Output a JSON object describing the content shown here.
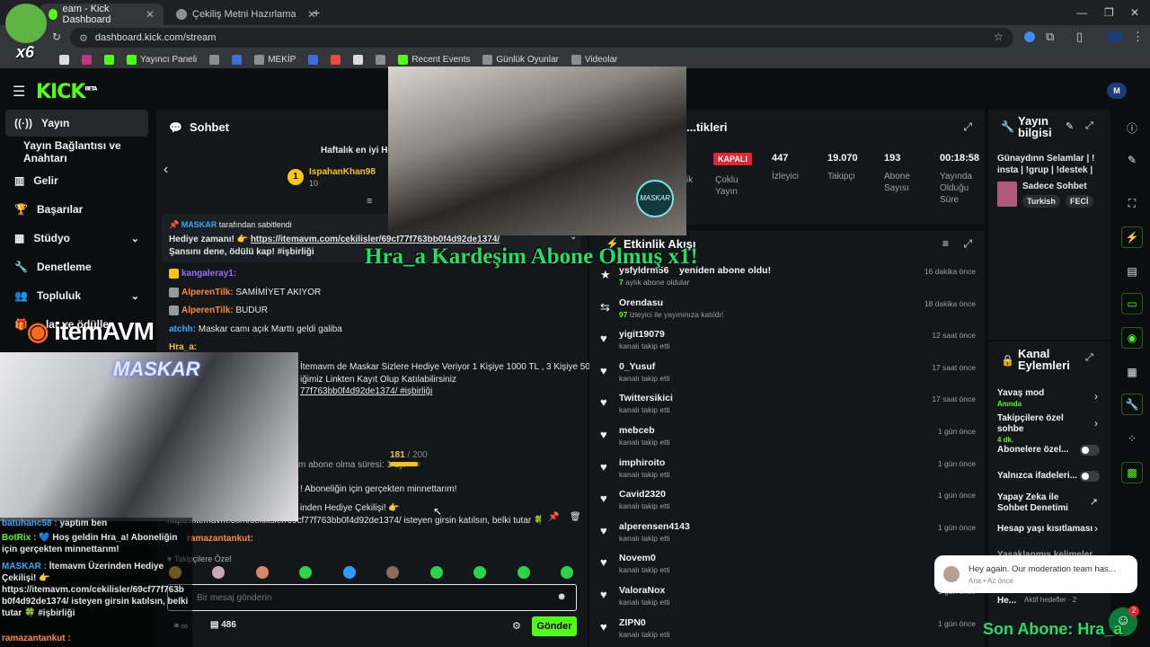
{
  "browser": {
    "tabs": [
      {
        "title": "eam - Kick Dashboard",
        "active": true
      },
      {
        "title": "Çekiliş Metni Hazırlama",
        "active": false
      }
    ],
    "url": "dashboard.kick.com/stream",
    "bookmarks": [
      "Yayıncı Paneli",
      "MEKİP",
      "Recent Events",
      "Günlük Oyunlar",
      "Videolar"
    ]
  },
  "kick": {
    "logo": "KICK",
    "logo_sup": "BETA",
    "avatar_label": "M"
  },
  "sidebar": {
    "items": [
      {
        "label": "Yayın",
        "icon": "broadcast-icon"
      },
      {
        "label": "Yayın Bağlantısı ve Anahtarı"
      },
      {
        "label": "Gelir",
        "icon": "revenue-icon"
      },
      {
        "label": "Başarılar",
        "icon": "trophy-icon"
      },
      {
        "label": "Stüdyo",
        "icon": "studio-icon"
      },
      {
        "label": "Denetleme",
        "icon": "wrench-icon"
      },
      {
        "label": "Topluluk",
        "icon": "community-icon"
      },
      {
        "label": "...lar ve ödüller",
        "icon": "rewards-icon"
      }
    ]
  },
  "chat": {
    "title": "Sohbet",
    "leaderboard_title": "Haftalık en iyi He...",
    "leader_name": "IspahanKhan98",
    "leader_rank": "1",
    "leader_value": "10",
    "pinned_by": "MASKAR",
    "pinned_suffix": "tarafından sabitlendi",
    "pinned_msg_prefix": "Hediye zamanı! 👉",
    "pinned_link": "https://itemavm.com/cekilisler/69cf77f763bb0f4d92de1374/",
    "pinned_msg_suffix": "Şansını dene, ödülü kap! #işbirliği",
    "messages": [
      {
        "user": "kangaleray1:",
        "text": ""
      },
      {
        "user": "AlperenTilk:",
        "text": "SAMİMİYET AKIYOR"
      },
      {
        "user": "AlperenTilk:",
        "text": "BUDUR"
      },
      {
        "user": "atchh:",
        "text": "Maskar camı açık Marttı geldi galiba"
      },
      {
        "user": "Hra_a:",
        "text": ""
      }
    ],
    "promo_line1": "İtemavm de Maskar Sizlere Hediye Veriyor 1 Kişiye 1000 TL , 3 Kişiye 500",
    "promo_line2": "iğimiz Linkten Kayıt Olup Katılabilirsiniz",
    "promo_line3": "77f763bb0f4d92de1374/ #işbirliği",
    "sub_progress_value": "181",
    "sub_progress_total": "/ 200",
    "sub_progress_fraction": 0.905,
    "sub_duration": "m abone olma süresi: 1 ay.",
    "thanks": "! Aboneliğin için gerçekten minnettarım!",
    "gift_line": "inden Hediye Çekilişi! 👉",
    "gift_link_line": "https://itemavm.com/cekilisler/69cf77f763bb0f4d92de1374/ isteyen girsin katılsın, belki tutar 🍀 #işbirliği",
    "ramazan_user": "ramazantankut:",
    "followers_only": "Takipçilere Özel",
    "input_placeholder": "Bir mesaj gönderin",
    "viewer_count": "486",
    "send_label": "Gönder"
  },
  "overlay_chat": [
    {
      "user": "batuhanc58 :",
      "text": "yaptım ben"
    },
    {
      "user": "BotRix :",
      "text": "💙 Hoş geldin Hra_a! Aboneliğin için gerçekten minnettarım!"
    },
    {
      "user": "MASKAR :",
      "text": "İtemavm Üzerinden Hediye Çekilişi! 👉 https://itemavm.com/cekilisler/69cf77f763b b0f4d92de1374/ isteyen girsin katılsın, belki tutar 🍀 #işbirliği"
    },
    {
      "user": "ramazantankut :",
      "text": ""
    }
  ],
  "stream_info": {
    "title": "...tikleri",
    "status": "KAPALI",
    "mode_label": "Çoklu Yayın",
    "partial_label": "ik",
    "stats": [
      {
        "value": "447",
        "label": "İzleyici"
      },
      {
        "value": "19.070",
        "label": "Takipçi"
      },
      {
        "value": "193",
        "label": "Abone Sayısı"
      },
      {
        "value": "00:18:58",
        "label": "Yayında Olduğu Süre"
      }
    ]
  },
  "activity": {
    "title": "Etkinlik Akışı",
    "items": [
      {
        "user": "ysfyldrm56",
        "action_inline": "yeniden abone oldu!",
        "detail_hl": "7",
        "detail": "aylık abone oldular",
        "time": "16 dakika önce",
        "icon": "star-icon"
      },
      {
        "user": "Orendasu",
        "action_inline": "",
        "detail_hl": "97",
        "detail": "izleyici ile yayınınıza katıldı!",
        "time": "18 dakika önce",
        "icon": "raid-icon"
      },
      {
        "user": "yigit19079",
        "detail": "kanalı takip etti",
        "time": "12 saat önce",
        "icon": "heart-icon"
      },
      {
        "user": "0_Yusuf",
        "detail": "kanalı takip etti",
        "time": "17 saat önce",
        "icon": "heart-icon"
      },
      {
        "user": "Twittersikici",
        "detail": "kanalı takip etti",
        "time": "17 saat önce",
        "icon": "heart-icon"
      },
      {
        "user": "mebceb",
        "detail": "kanalı takip etti",
        "time": "1 gün önce",
        "icon": "heart-icon"
      },
      {
        "user": "imphiroito",
        "detail": "kanalı takip etti",
        "time": "1 gün önce",
        "icon": "heart-icon"
      },
      {
        "user": "Cavid2320",
        "detail": "kanalı takip etti",
        "time": "1 gün önce",
        "icon": "heart-icon"
      },
      {
        "user": "alperensen4143",
        "detail": "kanalı takip etti",
        "time": "1 gün önce",
        "icon": "heart-icon"
      },
      {
        "user": "Novem0",
        "detail": "kanalı takip etti",
        "time": "1 gün önce",
        "icon": "heart-icon"
      },
      {
        "user": "ValoraNox",
        "detail": "kanalı takip etti",
        "time": "1 gün önce",
        "icon": "heart-icon"
      },
      {
        "user": "ZIPN0",
        "detail": "kanalı takip etti",
        "time": "1 gün önce",
        "icon": "heart-icon"
      }
    ]
  },
  "yayin_bilgisi": {
    "title": "Yayın bilgisi",
    "stream_title": "Günaydınn Selamlar | ! insta | !grup | !destek | ...",
    "category": "Sadece Sohbet",
    "tags": [
      "Turkish",
      "FECİ"
    ]
  },
  "kanal_eylemleri": {
    "title": "Kanal Eylemleri",
    "items": [
      {
        "label": "Yavaş mod",
        "sub": "Anında",
        "control": "chevron"
      },
      {
        "label": "Takipçilere özel sohbe",
        "sub": "4 dk.",
        "control": "chevron"
      },
      {
        "label": "Abonelere özel...",
        "control": "toggle"
      },
      {
        "label": "Yalnızca ifadeleri...",
        "control": "toggle"
      },
      {
        "label": "Yapay Zeka ile Sohbet Denetimi",
        "control": "external"
      },
      {
        "label": "Hesap yaşı kısıtlaması",
        "control": "chevron"
      },
      {
        "label": "Yasaklanmış kelimeler",
        "control": "chevron"
      },
      {
        "label": "He...",
        "control": "none"
      }
    ],
    "active_goals": "Aktif hedefler · 2"
  },
  "overlays": {
    "alert_text": "Hra_a Kardeşim Abone Olmuş x1!",
    "last_sub_text": "Son Abone: Hra_a",
    "itemavm_text": "itemAVM",
    "cam_logo": "MASKAR",
    "avatar_badge": "x6"
  },
  "toast": {
    "message": "Hey again.  Our moderation team has...",
    "meta": "Ana • Az önce",
    "badge": "2"
  },
  "colors": {
    "kick_green": "#53fc18",
    "alert_green": "#1ee36a",
    "status_red": "#e0262f",
    "panel_bg": "#14171a",
    "page_bg": "#0b0e0f"
  }
}
